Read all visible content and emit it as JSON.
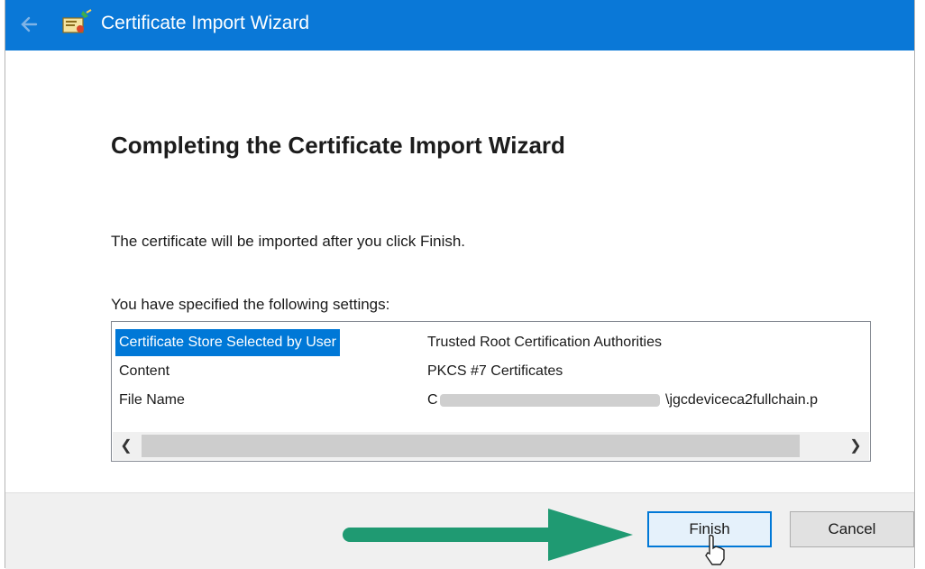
{
  "window": {
    "title": "Certificate Import Wizard",
    "titlebar_color": "#0a78d7"
  },
  "page": {
    "heading": "Completing the Certificate Import Wizard",
    "intro": "The certificate will be imported after you click Finish.",
    "settings_label": "You have specified the following settings:"
  },
  "settings": {
    "rows": [
      {
        "name": "Certificate Store Selected by User",
        "value": "Trusted Root Certification Authorities",
        "selected": true
      },
      {
        "name": "Content",
        "value": "PKCS #7 Certificates",
        "selected": false
      },
      {
        "name": "File Name",
        "value_prefix": "C",
        "value_suffix": "\\jgcdeviceca2fullchain.p",
        "selected": false
      }
    ]
  },
  "scrollbar": {
    "left_icon": "chevron-left-icon",
    "right_icon": "chevron-right-icon"
  },
  "buttons": {
    "finish": "Finish",
    "cancel": "Cancel"
  },
  "annotation": {
    "arrow_color": "#1f9a72",
    "cursor_icon": "mouse-pointer-icon"
  }
}
